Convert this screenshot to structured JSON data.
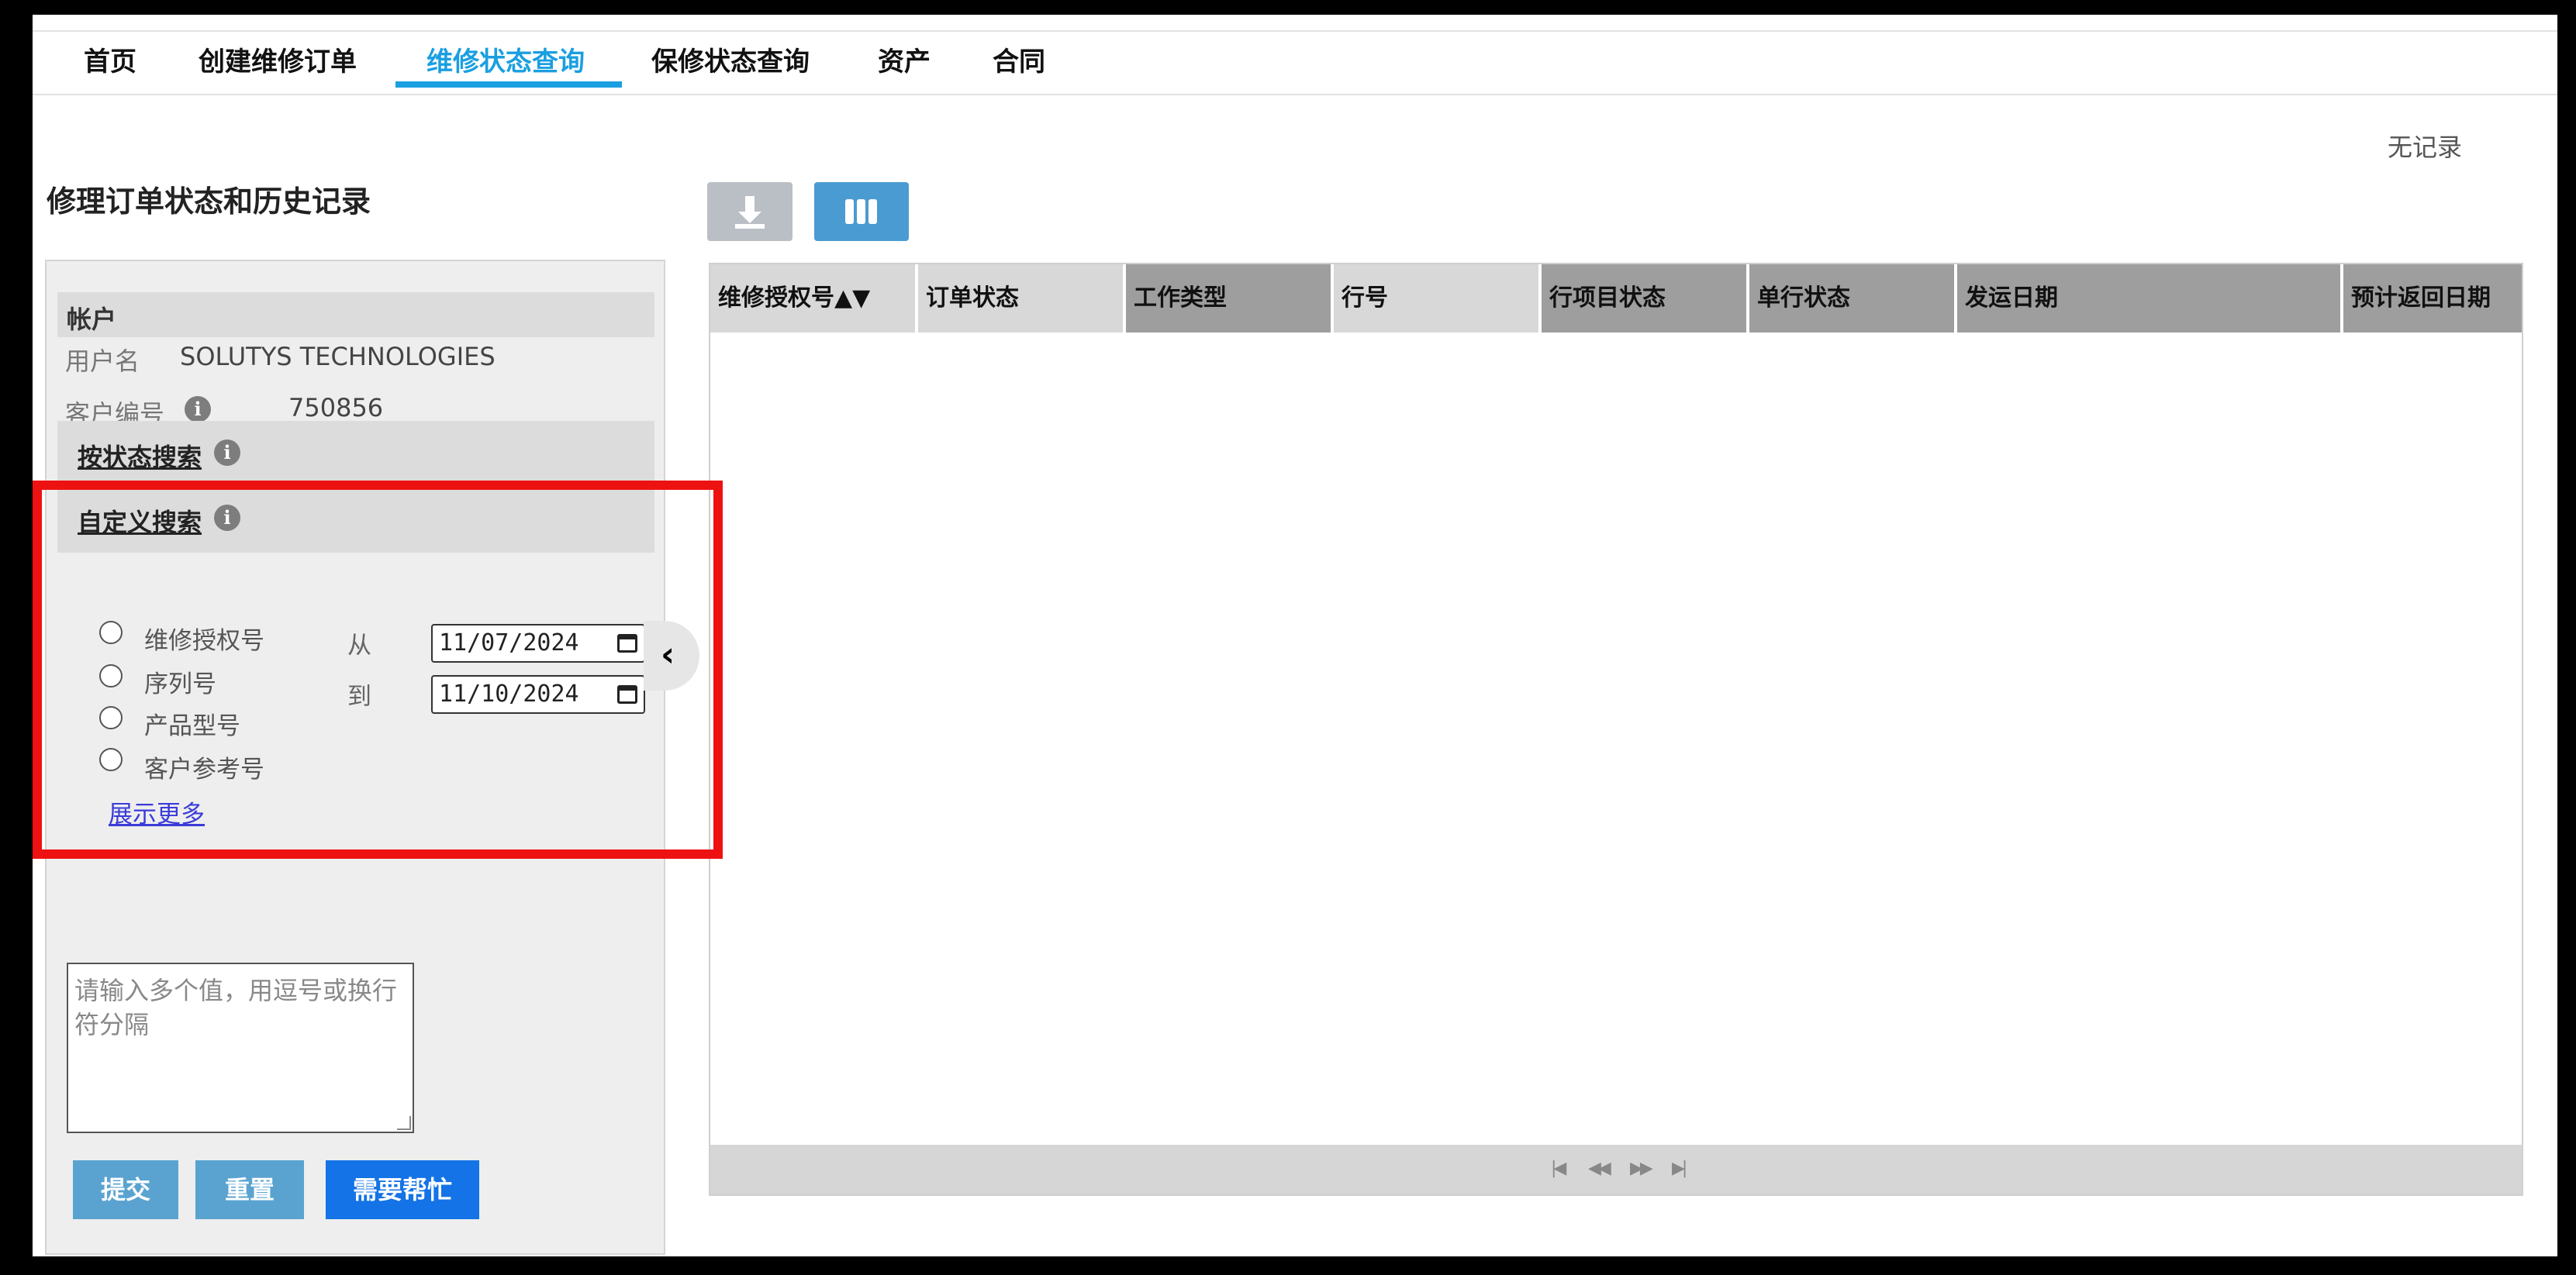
{
  "nav": {
    "items": [
      {
        "label": "首页"
      },
      {
        "label": "创建维修订单"
      },
      {
        "label": "维修状态查询"
      },
      {
        "label": "保修状态查询"
      },
      {
        "label": "资产"
      },
      {
        "label": "合同"
      }
    ],
    "active_index": 2
  },
  "no_record": "无记录",
  "page_title": "修理订单状态和历史记录",
  "account": {
    "header": "帐户",
    "username_label": "用户名",
    "username_value": "SOLUTYS TECHNOLOGIES",
    "customer_no_label": "客户编号",
    "customer_no_value": "750856"
  },
  "search": {
    "by_status": "按状态搜索",
    "custom": "自定义搜索",
    "options": [
      "维修授权号",
      "序列号",
      "产品型号",
      "客户参考号"
    ],
    "show_more": "展示更多",
    "from_label": "从",
    "to_label": "到",
    "from_date": "11/07/2024",
    "to_date": "11/10/2024",
    "textarea_placeholder": "请输入多个值，用逗号或换行符分隔"
  },
  "buttons": {
    "submit": "提交",
    "reset": "重置",
    "help": "需要帮忙"
  },
  "grid": {
    "columns": [
      {
        "label": "维修授权号▲▼"
      },
      {
        "label": "订单状态"
      },
      {
        "label": "工作类型"
      },
      {
        "label": "行号"
      },
      {
        "label": "行项目状态"
      },
      {
        "label": "单行状态"
      },
      {
        "label": "发运日期"
      },
      {
        "label": "预计返回日期"
      }
    ]
  },
  "icons": {
    "download": "download-icon",
    "columns": "columns-icon",
    "info": "info-icon",
    "collapse": "chevron-left-icon"
  },
  "colors": {
    "accent": "#1a9fe0",
    "button": "#5aa3d0",
    "help_button": "#1473e6"
  }
}
